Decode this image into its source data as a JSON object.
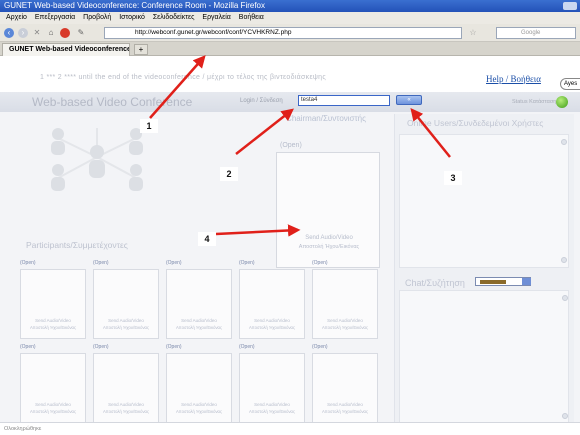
{
  "window": {
    "title": "GUNET Web-based Videoconference: Conference Room - Mozilla Firefox"
  },
  "menu": {
    "items": [
      "Αρχείο",
      "Επεξεργασία",
      "Προβολή",
      "Ιστορικό",
      "Σελιδοδείκτες",
      "Εργαλεία",
      "Βοήθεια"
    ]
  },
  "nav": {
    "url": "http://webconf.gunet.gr/webconf/conf/YCVHKRNZ.php",
    "search_placeholder": "Google"
  },
  "tabs": [
    {
      "label": "GUNET Web-based Videoconference: ..."
    },
    {
      "label": "+"
    }
  ],
  "banner": {
    "marquee": "1 *** 2 **** until the end of the videoconference / μέχρι το τέλος της βιντεοδιάσκεψης",
    "help": "Help / Βοήθεια",
    "oval_text": "Ayes"
  },
  "header": {
    "title": "Web-based Video Conference",
    "login_label": "Login / Σύνδεση",
    "login_value": "testa4",
    "login_button": "«",
    "status_label": "Status Κατάσταση"
  },
  "chairman": {
    "header": "Chairman/Συντονιστής",
    "open": "(Open)",
    "send": "Send Audio/Video",
    "send_sub": "Αποστολή Ήχου/Εικόνας"
  },
  "participants": {
    "header": "Participants/Συμμετέχοντες",
    "cells": [
      {
        "open": "(Open)",
        "send": "Send Audio/Video",
        "sub": "Αποστολή Ήχου/Εικόνας"
      },
      {
        "open": "(Open)",
        "send": "Send Audio/Video",
        "sub": "Αποστολή Ήχου/Εικόνας"
      },
      {
        "open": "(Open)",
        "send": "Send Audio/Video",
        "sub": "Αποστολή Ήχου/Εικόνας"
      },
      {
        "open": "(Open)",
        "send": "Send Audio/Video",
        "sub": "Αποστολή Ήχου/Εικόνας"
      },
      {
        "open": "(Open)",
        "send": "Send Audio/Video",
        "sub": "Αποστολή Ήχου/Εικόνας"
      },
      {
        "open": "(Open)",
        "send": "Send Audio/Video",
        "sub": "Αποστολή Ήχου/Εικόνας"
      },
      {
        "open": "(Open)",
        "send": "Send Audio/Video",
        "sub": "Αποστολή Ήχου/Εικόνας"
      },
      {
        "open": "(Open)",
        "send": "Send Audio/Video",
        "sub": "Αποστολή Ήχου/Εικόνας"
      },
      {
        "open": "(Open)",
        "send": "Send Audio/Video",
        "sub": "Αποστολή Ήχου/Εικόνας"
      },
      {
        "open": "(Open)",
        "send": "Send Audio/Video",
        "sub": "Αποστολή Ήχου/Εικόνας"
      }
    ]
  },
  "sidebar": {
    "online_header": "Online Users/Συνδεδεμένοι Χρήστες",
    "chat_header": "Chat/Συζήτηση"
  },
  "status_bar": {
    "text": "Ολοκληρώθηκε"
  },
  "annotations": [
    "1",
    "2",
    "3",
    "4"
  ],
  "colors": {
    "arrow": "#e0201a",
    "accent": "#3a66c8",
    "status_green": "#3d9c18"
  }
}
